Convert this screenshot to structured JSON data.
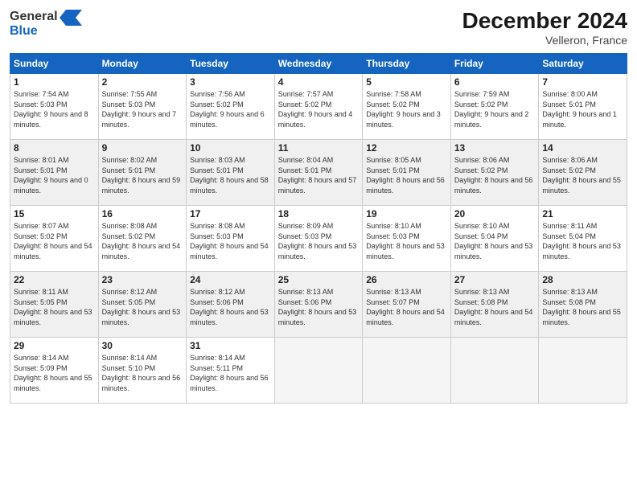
{
  "header": {
    "logo_text_general": "General",
    "logo_text_blue": "Blue",
    "month_year": "December 2024",
    "location": "Velleron, France"
  },
  "days_of_week": [
    "Sunday",
    "Monday",
    "Tuesday",
    "Wednesday",
    "Thursday",
    "Friday",
    "Saturday"
  ],
  "weeks": [
    [
      {
        "num": "1",
        "sunrise": "7:54 AM",
        "sunset": "5:03 PM",
        "daylight": "9 hours and 8 minutes."
      },
      {
        "num": "2",
        "sunrise": "7:55 AM",
        "sunset": "5:03 PM",
        "daylight": "9 hours and 7 minutes."
      },
      {
        "num": "3",
        "sunrise": "7:56 AM",
        "sunset": "5:02 PM",
        "daylight": "9 hours and 6 minutes."
      },
      {
        "num": "4",
        "sunrise": "7:57 AM",
        "sunset": "5:02 PM",
        "daylight": "9 hours and 4 minutes."
      },
      {
        "num": "5",
        "sunrise": "7:58 AM",
        "sunset": "5:02 PM",
        "daylight": "9 hours and 3 minutes."
      },
      {
        "num": "6",
        "sunrise": "7:59 AM",
        "sunset": "5:02 PM",
        "daylight": "9 hours and 2 minutes."
      },
      {
        "num": "7",
        "sunrise": "8:00 AM",
        "sunset": "5:01 PM",
        "daylight": "9 hours and 1 minute."
      }
    ],
    [
      {
        "num": "8",
        "sunrise": "8:01 AM",
        "sunset": "5:01 PM",
        "daylight": "9 hours and 0 minutes."
      },
      {
        "num": "9",
        "sunrise": "8:02 AM",
        "sunset": "5:01 PM",
        "daylight": "8 hours and 59 minutes."
      },
      {
        "num": "10",
        "sunrise": "8:03 AM",
        "sunset": "5:01 PM",
        "daylight": "8 hours and 58 minutes."
      },
      {
        "num": "11",
        "sunrise": "8:04 AM",
        "sunset": "5:01 PM",
        "daylight": "8 hours and 57 minutes."
      },
      {
        "num": "12",
        "sunrise": "8:05 AM",
        "sunset": "5:01 PM",
        "daylight": "8 hours and 56 minutes."
      },
      {
        "num": "13",
        "sunrise": "8:06 AM",
        "sunset": "5:02 PM",
        "daylight": "8 hours and 56 minutes."
      },
      {
        "num": "14",
        "sunrise": "8:06 AM",
        "sunset": "5:02 PM",
        "daylight": "8 hours and 55 minutes."
      }
    ],
    [
      {
        "num": "15",
        "sunrise": "8:07 AM",
        "sunset": "5:02 PM",
        "daylight": "8 hours and 54 minutes."
      },
      {
        "num": "16",
        "sunrise": "8:08 AM",
        "sunset": "5:02 PM",
        "daylight": "8 hours and 54 minutes."
      },
      {
        "num": "17",
        "sunrise": "8:08 AM",
        "sunset": "5:03 PM",
        "daylight": "8 hours and 54 minutes."
      },
      {
        "num": "18",
        "sunrise": "8:09 AM",
        "sunset": "5:03 PM",
        "daylight": "8 hours and 53 minutes."
      },
      {
        "num": "19",
        "sunrise": "8:10 AM",
        "sunset": "5:03 PM",
        "daylight": "8 hours and 53 minutes."
      },
      {
        "num": "20",
        "sunrise": "8:10 AM",
        "sunset": "5:04 PM",
        "daylight": "8 hours and 53 minutes."
      },
      {
        "num": "21",
        "sunrise": "8:11 AM",
        "sunset": "5:04 PM",
        "daylight": "8 hours and 53 minutes."
      }
    ],
    [
      {
        "num": "22",
        "sunrise": "8:11 AM",
        "sunset": "5:05 PM",
        "daylight": "8 hours and 53 minutes."
      },
      {
        "num": "23",
        "sunrise": "8:12 AM",
        "sunset": "5:05 PM",
        "daylight": "8 hours and 53 minutes."
      },
      {
        "num": "24",
        "sunrise": "8:12 AM",
        "sunset": "5:06 PM",
        "daylight": "8 hours and 53 minutes."
      },
      {
        "num": "25",
        "sunrise": "8:13 AM",
        "sunset": "5:06 PM",
        "daylight": "8 hours and 53 minutes."
      },
      {
        "num": "26",
        "sunrise": "8:13 AM",
        "sunset": "5:07 PM",
        "daylight": "8 hours and 54 minutes."
      },
      {
        "num": "27",
        "sunrise": "8:13 AM",
        "sunset": "5:08 PM",
        "daylight": "8 hours and 54 minutes."
      },
      {
        "num": "28",
        "sunrise": "8:13 AM",
        "sunset": "5:08 PM",
        "daylight": "8 hours and 55 minutes."
      }
    ],
    [
      {
        "num": "29",
        "sunrise": "8:14 AM",
        "sunset": "5:09 PM",
        "daylight": "8 hours and 55 minutes."
      },
      {
        "num": "30",
        "sunrise": "8:14 AM",
        "sunset": "5:10 PM",
        "daylight": "8 hours and 56 minutes."
      },
      {
        "num": "31",
        "sunrise": "8:14 AM",
        "sunset": "5:11 PM",
        "daylight": "8 hours and 56 minutes."
      },
      null,
      null,
      null,
      null
    ]
  ]
}
